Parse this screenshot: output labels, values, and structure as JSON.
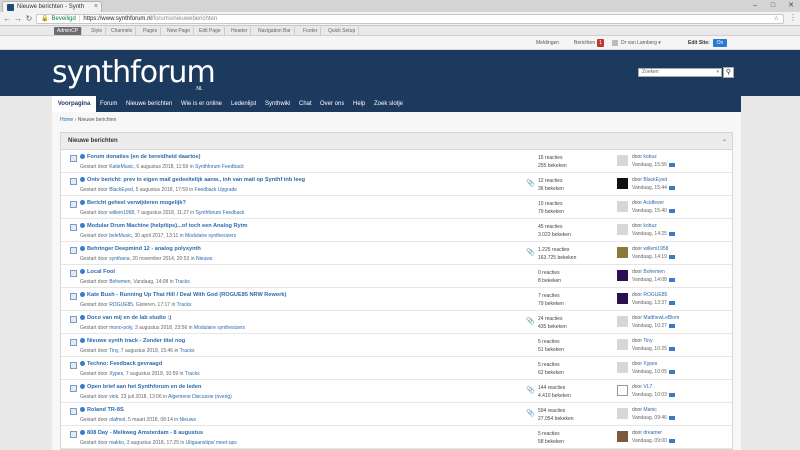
{
  "browser": {
    "tab_title": "Nieuwe berichten - Synth",
    "address": {
      "security_label": "Beveiligd",
      "host": "https://www.synthforum.nl",
      "path": "/forums/nieuweberichten"
    }
  },
  "admin_bar": {
    "items": [
      "AdminCP",
      "Style",
      "Channels",
      "Pages",
      "New Page",
      "Edit Page",
      "Header",
      "Navigation Bar",
      "Footer",
      "Quick Setup"
    ]
  },
  "account_bar": {
    "meldingen": "Meldingen",
    "berichten": "Berichten",
    "berichten_count": "1",
    "user": "Dr van Lamberg",
    "edit_site": "Edit Site:",
    "toggle": "On"
  },
  "header": {
    "logo": "synthforum",
    "logo_suffix": ".NL",
    "search_placeholder": "Zoeken"
  },
  "nav": {
    "items": [
      "Voorpagina",
      "Forum",
      "Nieuwe berichten",
      "Wie is er online",
      "Ledenlijst",
      "Synthwiki",
      "Chat",
      "Over ons",
      "Help",
      "Zoek slotje"
    ]
  },
  "breadcrumb": {
    "home": "Home",
    "current": "Nieuwe berichten"
  },
  "panel": {
    "title": "Nieuwe berichten",
    "collapse": "−"
  },
  "threads": [
    {
      "title": "Forum donaties (en de bereidheid daartoe)",
      "started_by": "KatieMusic",
      "date": "6 augustus 2018, 11:59",
      "forum": "Synthforum Feedback",
      "replies": "15 reacties",
      "views": "255 bekeken",
      "last_user": "kobuz",
      "last_time": "Vandaag, 15:56",
      "avatar": "grey",
      "attachment": false
    },
    {
      "title": "Ontv bericht: prev in eigen mail gedeeltelijk aanw., inh van mail op Synthf inb leeg",
      "started_by": "BlackEyed",
      "date": "5 augustus 2018, 17:59",
      "forum": "Feedback Upgrade",
      "replies": "12 reacties",
      "views": "36 bekeken",
      "last_user": "BlackEyed",
      "last_time": "Vandaag, 15:44",
      "avatar": "dark",
      "attachment": true
    },
    {
      "title": "Bericht geheel verwijderen mogelijk?",
      "started_by": "willem1958",
      "date": "7 augustus 2018, 11:27",
      "forum": "Synthforum Feedback",
      "replies": "10 reacties",
      "views": "79 bekeken",
      "last_user": "Acidfever",
      "last_time": "Vandaag, 15:40",
      "avatar": "grey",
      "attachment": false
    },
    {
      "title": "Modular Drum Machine (help/tips)...of toch een Analog Rytm",
      "started_by": "beleMusic",
      "date": "30 april 2017, 13:11",
      "forum": "Modulaire synthesizers",
      "replies": "45 reacties",
      "views": "3.023 bekeken",
      "last_user": "kobuz",
      "last_time": "Vandaag, 14:25",
      "avatar": "grey",
      "attachment": false
    },
    {
      "title": "Behringer Deepmind 12 - analog polysynth",
      "started_by": "synthana",
      "date": "20 november 2014, 20:53",
      "forum": "Nieuws",
      "replies": "1.225 reacties",
      "views": "163.725 bekeken",
      "last_user": "willem1958",
      "last_time": "Vandaag, 14:19",
      "avatar": "photo",
      "attachment": true
    },
    {
      "title": "Local Fool",
      "started_by": "Bohemen",
      "date": "Vandaag, 14:08",
      "forum": "Tracks",
      "replies": "0 reacties",
      "views": "8 bekeken",
      "last_user": "Bohemen",
      "last_time": "Vandaag, 14:08",
      "avatar": "purple",
      "attachment": false
    },
    {
      "title": "Kate Bush - Running Up That Hill / Deal With God (ROGUE85 NRW Rework)",
      "started_by": "ROGUE85",
      "date": "Gisteren, 17:17",
      "forum": "Tracks",
      "replies": "7 reacties",
      "views": "79 bekeken",
      "last_user": "ROGUE85",
      "last_time": "Vandaag, 13:37",
      "avatar": "purple",
      "attachment": false
    },
    {
      "title": "Doco van mij en de lab studio :)",
      "started_by": "mono-poly",
      "date": "3 augustus 2018, 23:56",
      "forum": "Modulaire synthesizers",
      "replies": "24 reacties",
      "views": "435 bekeken",
      "last_user": "MatthewLeBlom",
      "last_time": "Vandaag, 10:27",
      "avatar": "grey",
      "attachment": true
    },
    {
      "title": "Nieuwe synth track - Zonder titel nog",
      "started_by": "Tiny",
      "date": "7 augustus 2018, 15:46",
      "forum": "Tracks",
      "replies": "5 reacties",
      "views": "51 bekeken",
      "last_user": "Tiny",
      "last_time": "Vandaag, 10:25",
      "avatar": "grey",
      "attachment": false
    },
    {
      "title": "Techno: Feedback gevraagd",
      "started_by": "Xypes",
      "date": "7 augustus 2018, 10:59",
      "forum": "Tracks",
      "replies": "5 reacties",
      "views": "62 bekeken",
      "last_user": "Xypes",
      "last_time": "Vandaag, 10:05",
      "avatar": "grey",
      "attachment": false
    },
    {
      "title": "Open brief aan het Synthforum en de leden",
      "started_by": "vink",
      "date": "23 juli 2018, 13:06",
      "forum": "Algemene Discussie (overig)",
      "replies": "144 reacties",
      "views": "4.410 bekeken",
      "last_user": "VL7",
      "last_time": "Vandaag, 10:03",
      "avatar": "vl7",
      "attachment": true
    },
    {
      "title": "Roland TR-8S",
      "started_by": "olafmol",
      "date": "5 maart 2018, 08:14",
      "forum": "Nieuws",
      "replies": "594 reacties",
      "views": "27.054 bekeken",
      "last_user": "Manic",
      "last_time": "Vandaag, 09:46",
      "avatar": "grey",
      "attachment": true
    },
    {
      "title": "808 Day - Meikweg Amsterdam - 8 augustus",
      "started_by": "makko",
      "date": "3 augustus 2018, 17:25",
      "forum": "Uitgaanstips/ meet-ups",
      "replies": "5 reacties",
      "views": "58 bekeken",
      "last_user": "dreamer",
      "last_time": "Vandaag, 09:00",
      "avatar": "photo2",
      "attachment": false
    }
  ],
  "labels": {
    "started_prefix": "Gestart door",
    "in": "in",
    "by": "door"
  }
}
